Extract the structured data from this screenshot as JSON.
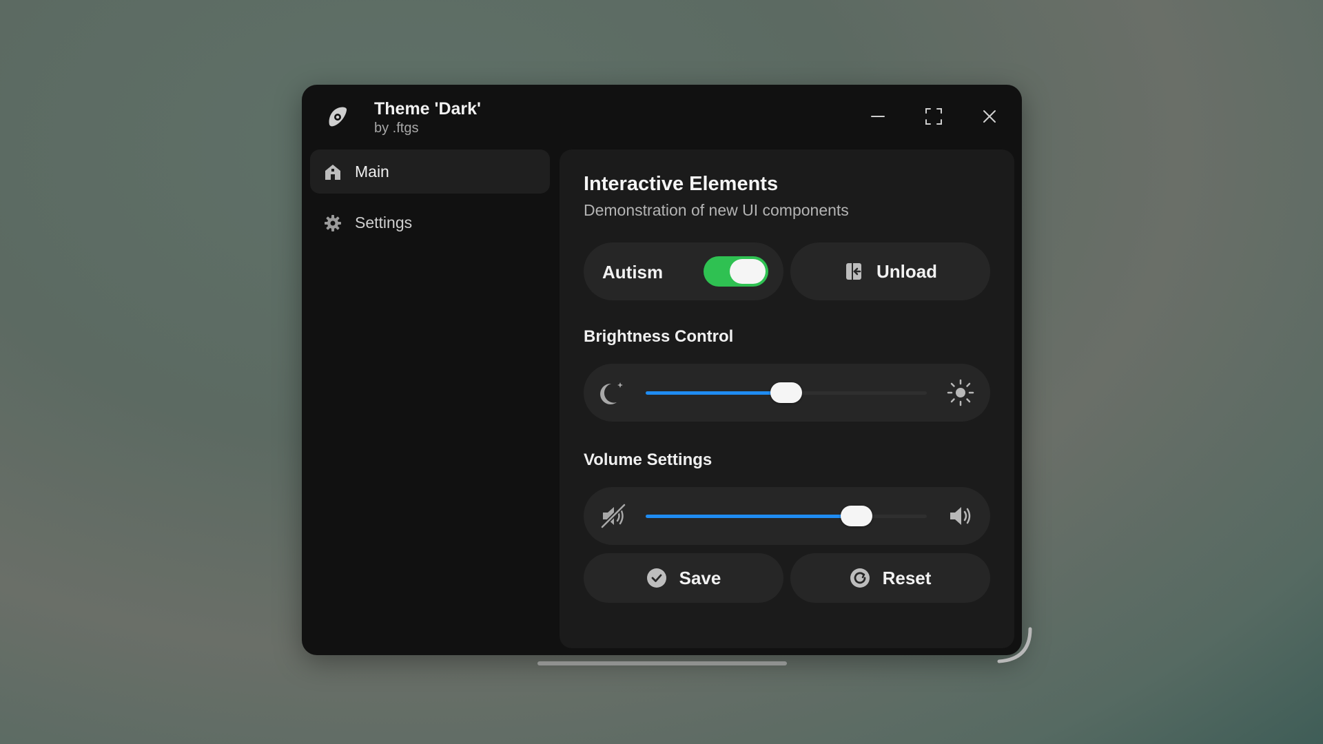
{
  "window": {
    "title": "Theme 'Dark'",
    "subtitle": "by .ftgs",
    "controls": [
      "minimize-icon",
      "maximize-icon",
      "close-icon"
    ]
  },
  "sidebar": {
    "items": [
      {
        "label": "Main",
        "icon": "home-icon",
        "active": true
      },
      {
        "label": "Settings",
        "icon": "gear-icon",
        "active": false
      }
    ]
  },
  "main": {
    "title": "Interactive Elements",
    "description": "Demonstration of new UI components",
    "toggle": {
      "label": "Autism",
      "on": true
    },
    "unload_button": {
      "label": "Unload",
      "icon": "unload-icon"
    },
    "brightness": {
      "heading": "Brightness Control",
      "value_percent": 50,
      "left_icon": "moon-icon",
      "right_icon": "sun-icon"
    },
    "volume": {
      "heading": "Volume Settings",
      "value_percent": 75,
      "left_icon": "mute-icon",
      "right_icon": "speaker-icon"
    },
    "save_button": {
      "label": "Save",
      "icon": "check-circle-icon"
    },
    "reset_button": {
      "label": "Reset",
      "icon": "reset-icon"
    }
  },
  "colors": {
    "accent_blue": "#1f8cf2",
    "toggle_green": "#2fc152",
    "window_bg": "#111111",
    "panel_bg": "#1b1b1b",
    "control_bg": "#262626"
  }
}
